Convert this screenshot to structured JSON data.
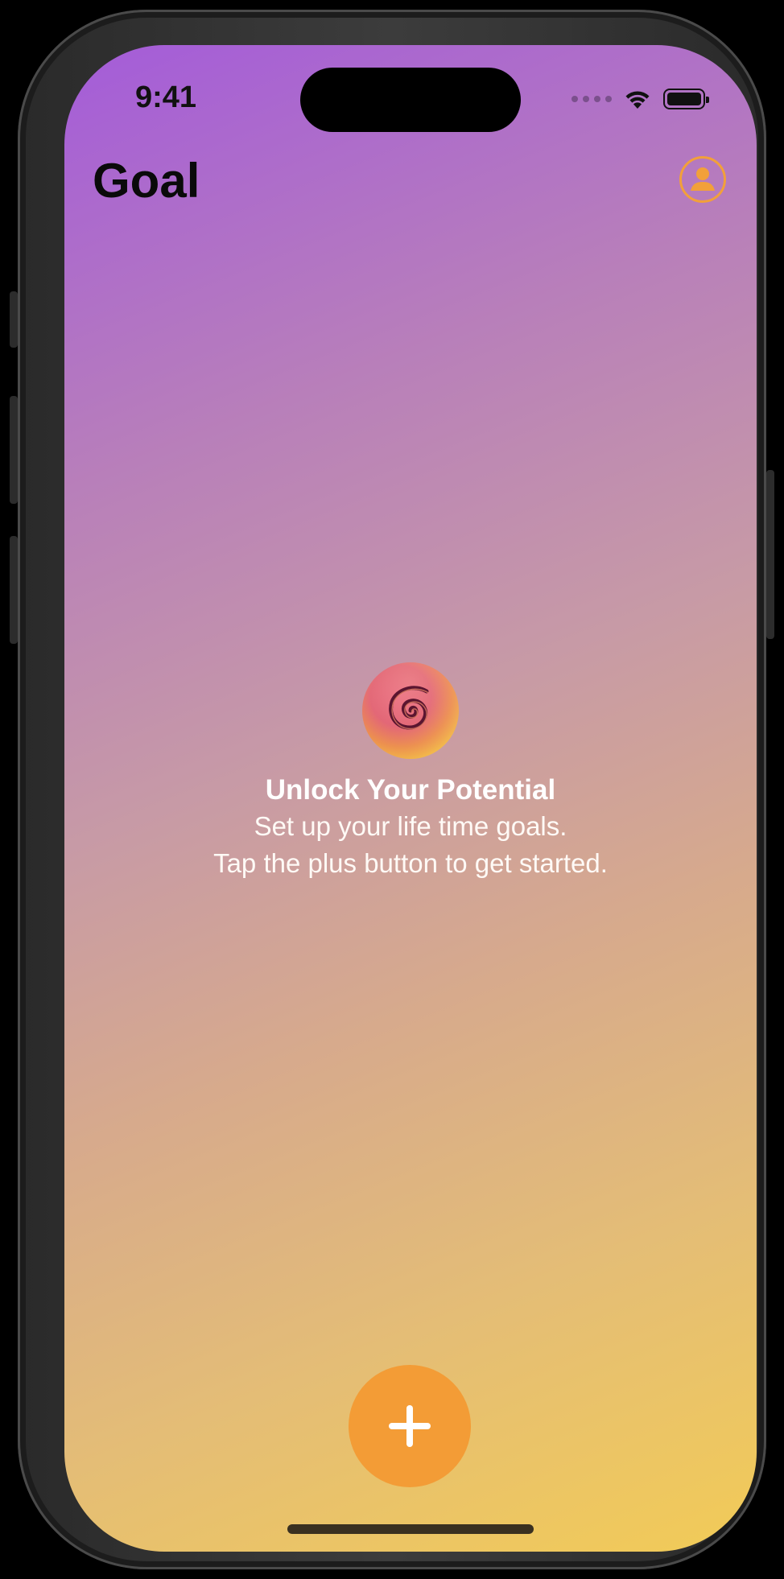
{
  "status_bar": {
    "time": "9:41",
    "icons": [
      "cellular-signal-icon",
      "wifi-icon",
      "battery-icon"
    ]
  },
  "header": {
    "title": "Goal",
    "profile_icon": "person-circle-icon"
  },
  "empty_state": {
    "icon": "spiral-icon",
    "headline": "Unlock Your Potential",
    "line1": "Set up your life time goals.",
    "line2": "Tap the plus button to get started."
  },
  "fab": {
    "icon": "plus-icon"
  },
  "colors": {
    "accent": "#F39C36",
    "gradient_top": "#A45CD9",
    "gradient_bottom": "#F2CB57",
    "text_primary": "#0A0A0A",
    "text_on_background": "#FFFFFF"
  }
}
